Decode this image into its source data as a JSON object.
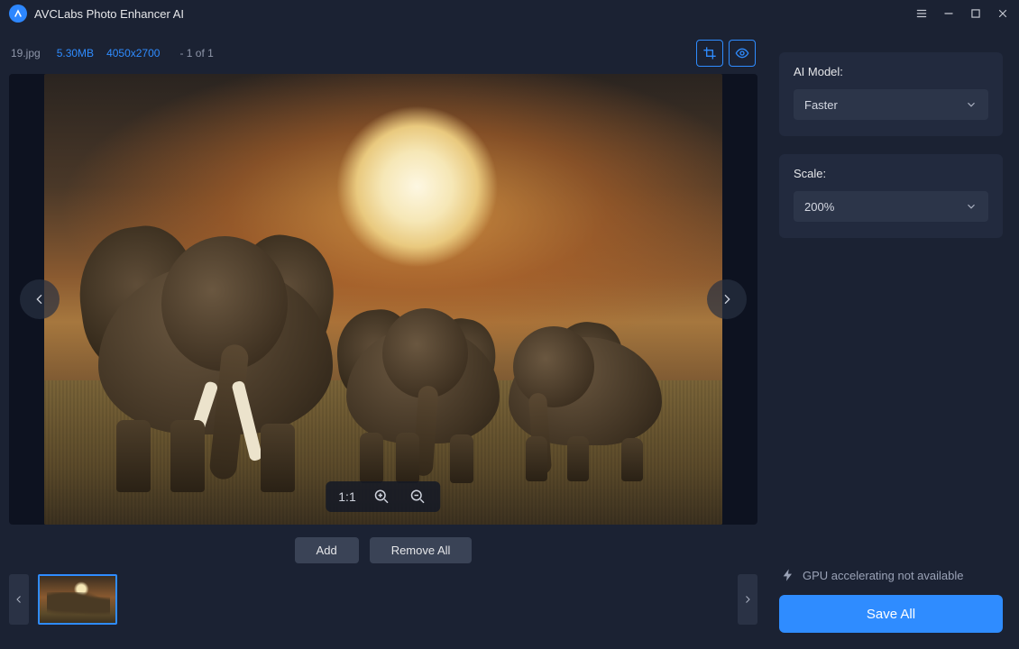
{
  "titlebar": {
    "app_title": "AVCLabs Photo Enhancer AI"
  },
  "file": {
    "name": "19.jpg",
    "size": "5.30MB",
    "dimensions": "4050x2700",
    "counter": "- 1 of 1"
  },
  "viewer": {
    "zoom_label": "1:1"
  },
  "actions": {
    "add": "Add",
    "remove_all": "Remove All"
  },
  "sidebar": {
    "ai_model": {
      "label": "AI Model:",
      "value": "Faster"
    },
    "scale": {
      "label": "Scale:",
      "value": "200%"
    },
    "gpu_status": "GPU accelerating not available",
    "save_all": "Save All"
  }
}
